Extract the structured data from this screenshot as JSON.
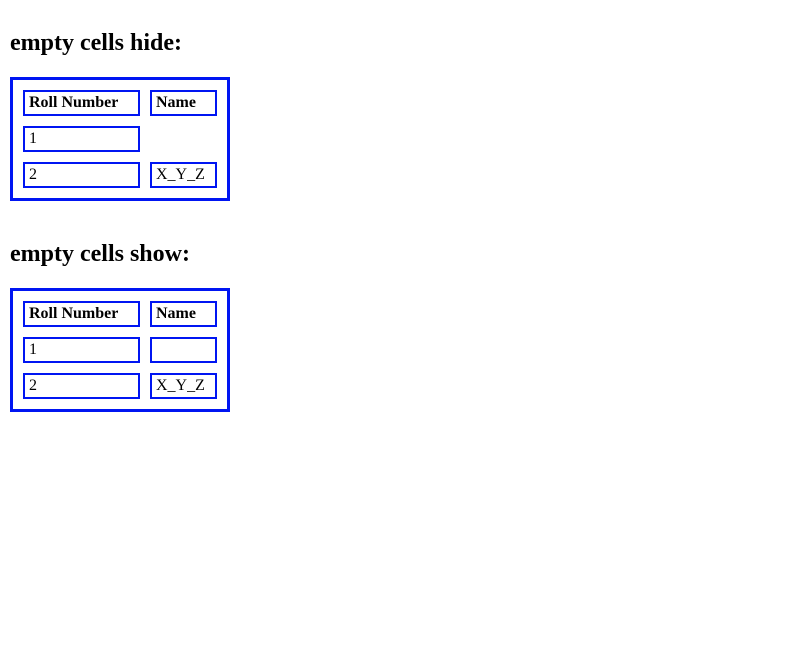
{
  "section1": {
    "heading": "empty cells hide:",
    "headers": [
      "Roll Number",
      "Name"
    ],
    "rows": [
      {
        "roll": "1",
        "name": ""
      },
      {
        "roll": "2",
        "name": "X_Y_Z"
      }
    ]
  },
  "section2": {
    "heading": "empty cells show:",
    "headers": [
      "Roll Number",
      "Name"
    ],
    "rows": [
      {
        "roll": "1",
        "name": ""
      },
      {
        "roll": "2",
        "name": "X_Y_Z"
      }
    ]
  }
}
